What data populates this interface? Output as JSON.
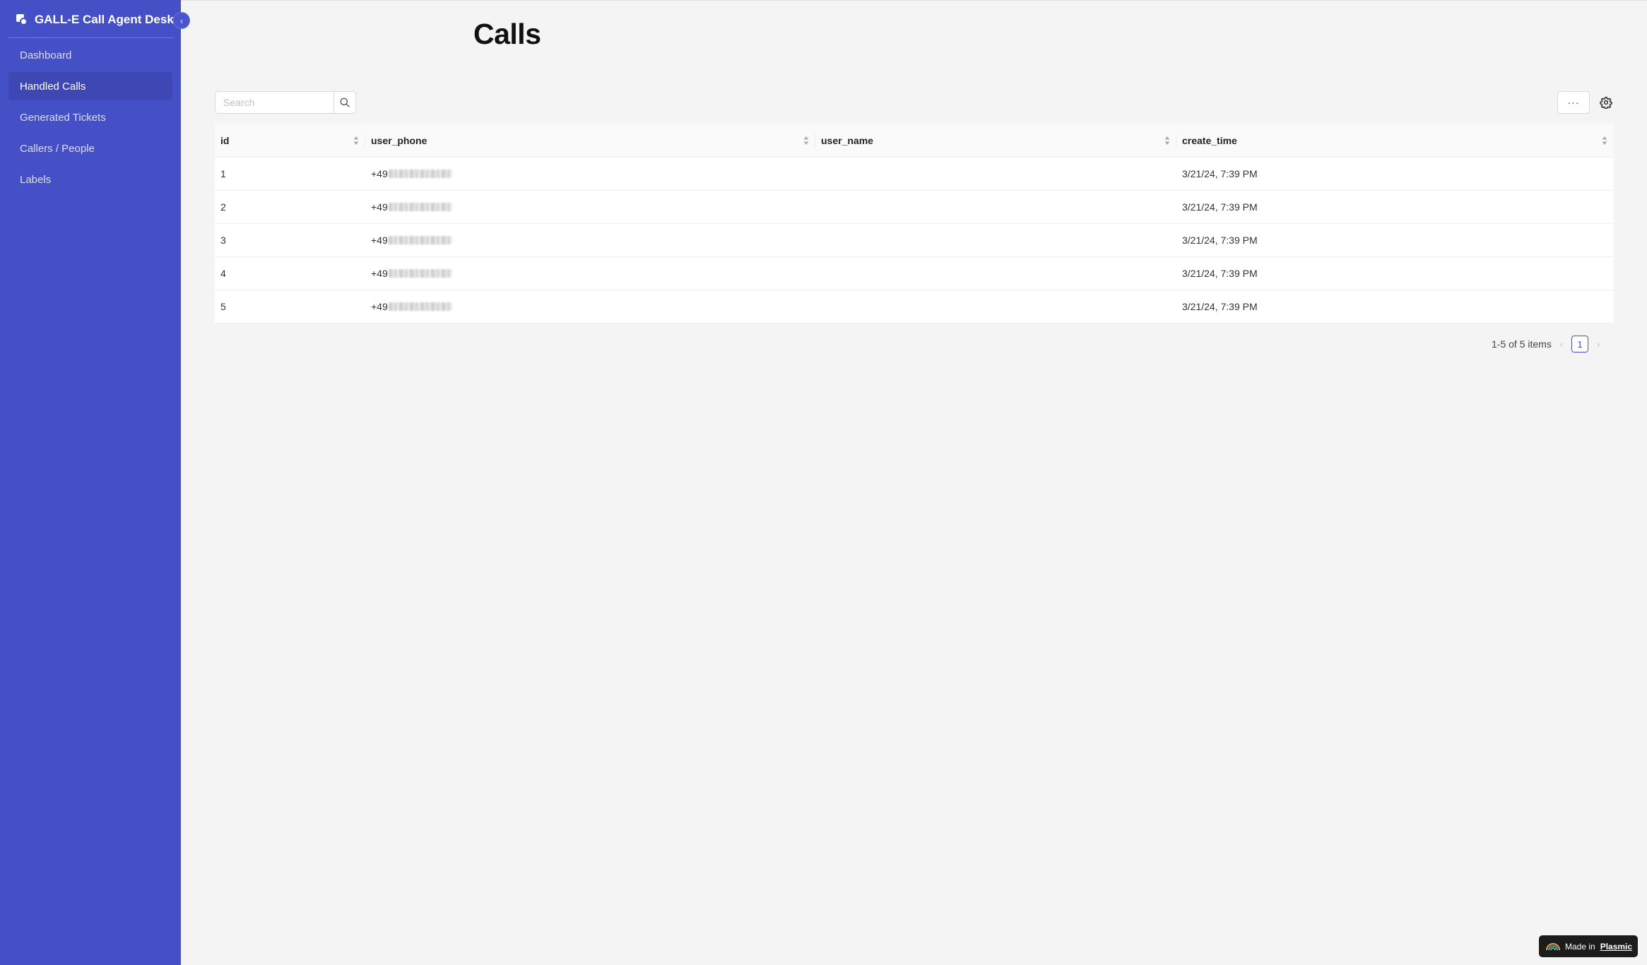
{
  "app": {
    "title": "GALL-E Call Agent Desk",
    "collapse_icon": "‹"
  },
  "sidebar": {
    "items": [
      {
        "label": "Dashboard",
        "active": false
      },
      {
        "label": "Handled Calls",
        "active": true
      },
      {
        "label": "Generated Tickets",
        "active": false
      },
      {
        "label": "Callers / People",
        "active": false
      },
      {
        "label": "Labels",
        "active": false
      }
    ]
  },
  "page": {
    "title": "Calls"
  },
  "search": {
    "placeholder": "Search",
    "value": ""
  },
  "toolbar": {
    "more_label": "···"
  },
  "table": {
    "columns": [
      "id",
      "user_phone",
      "user_name",
      "create_time"
    ],
    "rows": [
      {
        "id": "1",
        "user_phone": "+49",
        "user_name": "",
        "create_time": "3/21/24, 7:39 PM"
      },
      {
        "id": "2",
        "user_phone": "+49",
        "user_name": "",
        "create_time": "3/21/24, 7:39 PM"
      },
      {
        "id": "3",
        "user_phone": "+49",
        "user_name": "",
        "create_time": "3/21/24, 7:39 PM"
      },
      {
        "id": "4",
        "user_phone": "+49",
        "user_name": "",
        "create_time": "3/21/24, 7:39 PM"
      },
      {
        "id": "5",
        "user_phone": "+49",
        "user_name": "",
        "create_time": "3/21/24, 7:39 PM"
      }
    ]
  },
  "pagination": {
    "summary": "1-5 of 5 items",
    "current_page": "1",
    "prev": "‹",
    "next": "›"
  },
  "badge": {
    "prefix": "Made in",
    "link": "Plasmic"
  },
  "colors": {
    "sidebar_bg": "#4650c6",
    "sidebar_active": "#3e47b3",
    "page_bg": "#f4f4f4",
    "accent": "#4650c6"
  }
}
